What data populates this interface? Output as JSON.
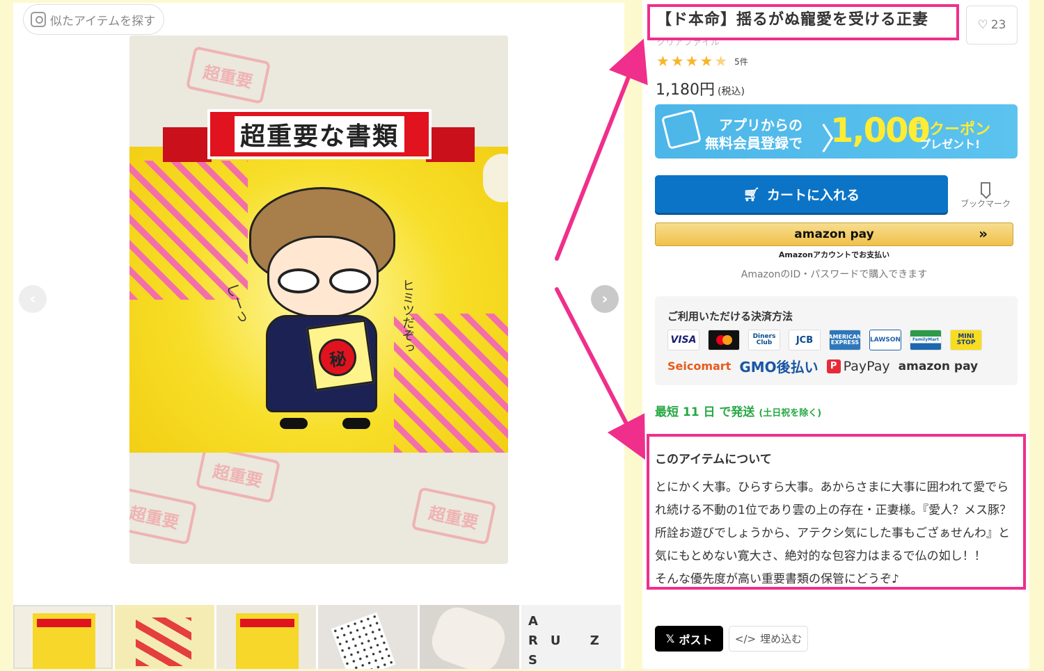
{
  "gallery": {
    "similar_label": "似たアイテムを探す",
    "design": {
      "ribbon_text": "超重要な書類",
      "stamp_text": "超重要",
      "seal_text": "秘",
      "shh_text": "しーっ",
      "himitsu_text": "ヒミツだぞっ",
      "accent_pink": "#f36fa9",
      "accent_yellow": "#f6d72a",
      "accent_red": "#e0131f"
    },
    "prev_icon": "chevron-left-icon",
    "next_icon": "chevron-right-icon",
    "thumbnail_count": 6
  },
  "product": {
    "title": "【ド本命】揺るがぬ寵愛を受ける正妻",
    "subtitle": "クリアファイル",
    "likes": "23",
    "rating": 4.5,
    "review_count": "5件",
    "price": "1,180円",
    "price_tax": "(税込)"
  },
  "banner": {
    "line1": "アプリからの",
    "line2": "無料会員登録で",
    "amount": "1,000",
    "unit": "円クーポン",
    "suffix": "プレゼント!"
  },
  "actions": {
    "cart_label": "カートに入れる",
    "bookmark_label": "ブックマーク",
    "amazon_label": "amazon pay",
    "amazon_arrows": "»",
    "amazon_sub": "Amazonアカウントでお支払い",
    "amazon_note": "AmazonのID・パスワードで購入できます"
  },
  "payments": {
    "title": "ご利用いただける決済方法",
    "cards": [
      "VISA",
      "",
      "Diners Club",
      "JCB",
      "AMERICAN EXPRESS",
      "LAWSON",
      "FamilyMart",
      "MINI STOP"
    ],
    "seicomart": "Seicomart",
    "gmo": "GMO後払い",
    "paypay": "PayPay",
    "amazonpay": "amazon pay"
  },
  "shipping": {
    "text": "最短 11 日 で発送",
    "note": "(土日祝を除く)"
  },
  "about": {
    "heading": "このアイテムについて",
    "body": "とにかく大事。ひらすら大事。あからさまに大事に囲われて愛でられ続ける不動の1位であり雲の上の存在・正妻様。『愛人？メス豚？所詮お遊びでしょうから、アテクシ気にした事もござぁせんわ』と気にもとめない寛大さ、絶対的な包容力はまるで仏の如し！！",
    "tail": "そんな優先度が高い重要書類の保管にどうぞ♪"
  },
  "share": {
    "post_label": "ポスト",
    "embed_label": "埋め込む"
  },
  "annotation_color": "#ef2f8b"
}
